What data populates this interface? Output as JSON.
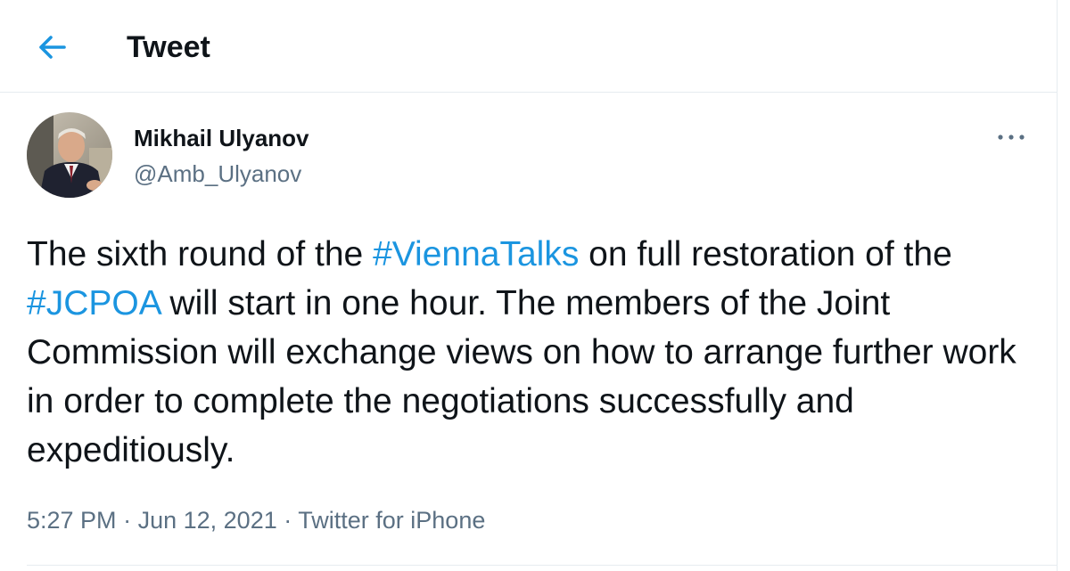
{
  "header": {
    "back_icon": "arrow-left-icon",
    "title": "Tweet"
  },
  "tweet": {
    "author": {
      "name": "Mikhail Ulyanov",
      "handle": "@Amb_Ulyanov",
      "avatar": "avatar-photo"
    },
    "more_icon": "more-horizontal-icon",
    "text_segments": [
      "The sixth round of the ",
      "#ViennaTalks",
      " on full restoration of the ",
      "#JCPOA",
      " will start in one hour. The members of the Joint Commission will exchange views on how to arrange further work in order to complete the negotiations successfully and expeditiously."
    ],
    "time": "5:27 PM",
    "date": "Jun 12, 2021",
    "separator": "·",
    "source": "Twitter for iPhone"
  },
  "colors": {
    "accent": "#1b95e0",
    "text_primary": "#0f1419",
    "text_secondary": "#5b7083",
    "divider": "#e6ecf0"
  }
}
